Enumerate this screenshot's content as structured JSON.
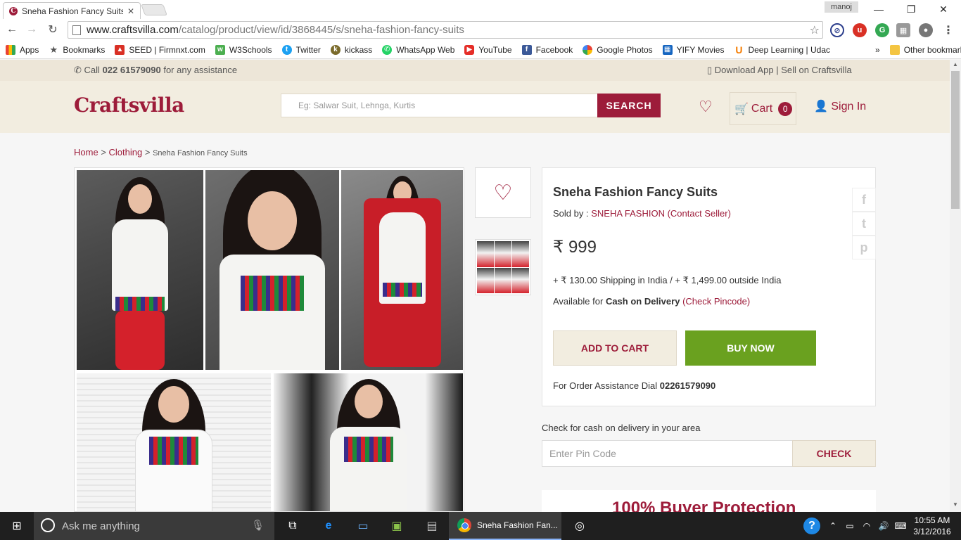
{
  "browser": {
    "tab_title": "Sneha Fashion Fancy Suits",
    "profile_name": "manoj",
    "url_host": "www.craftsvilla.com",
    "url_path": "/catalog/product/view/id/3868445/s/sneha-fashion-fancy-suits",
    "bookmarks": [
      "Apps",
      "Bookmarks",
      "SEED | Firmnxt.com",
      "W3Schools",
      "Twitter",
      "kickass",
      "WhatsApp Web",
      "YouTube",
      "Facebook",
      "Google Photos",
      "YIFY Movies",
      "Deep Learning | Udac"
    ],
    "other_bookmarks": "Other bookmarks",
    "overflow": "»"
  },
  "topbar": {
    "call_prefix": "Call",
    "phone": "022 61579090",
    "call_suffix": "for any assistance",
    "download_app": "Download App",
    "separator": "|",
    "sell": "Sell on Craftsvilla"
  },
  "header": {
    "logo": "Craftsvilla",
    "search_placeholder": "Eg: Salwar Suit, Lehnga, Kurtis",
    "search_button": "SEARCH",
    "cart_label": "Cart",
    "cart_count": "0",
    "signin": "Sign In"
  },
  "breadcrumb": {
    "home": "Home",
    "category": "Clothing",
    "current": "Sneha Fashion Fancy Suits",
    "sep": ">"
  },
  "product": {
    "title": "Sneha Fashion Fancy Suits",
    "sold_by_label": "Sold by :",
    "seller": "SNEHA FASHION",
    "contact": "(Contact Seller)",
    "price": "₹ 999",
    "shipping": "+ ₹ 130.00 Shipping in India / + ₹ 1,499.00 outside India",
    "available_for": "Available for",
    "cod": "Cash on Delivery",
    "check_pincode": "(Check Pincode)",
    "add_to_cart": "ADD TO CART",
    "buy_now": "BUY NOW",
    "assist_label": "For Order Assistance Dial",
    "assist_phone": "02261579090"
  },
  "social": [
    "f",
    "t",
    "p"
  ],
  "pincode": {
    "label": "Check for cash on delivery in your area",
    "placeholder": "Enter Pin Code",
    "button": "CHECK"
  },
  "protection": "100% Buyer Protection",
  "taskbar": {
    "search_placeholder": "Ask me anything",
    "chrome_label": "Sneha Fashion Fan...",
    "time": "10:55 AM",
    "date": "3/12/2016"
  },
  "colors": {
    "brand": "#9d1c3a",
    "buy_now": "#6aa11f",
    "topbar": "#ede6d8",
    "header": "#f2ede0"
  }
}
